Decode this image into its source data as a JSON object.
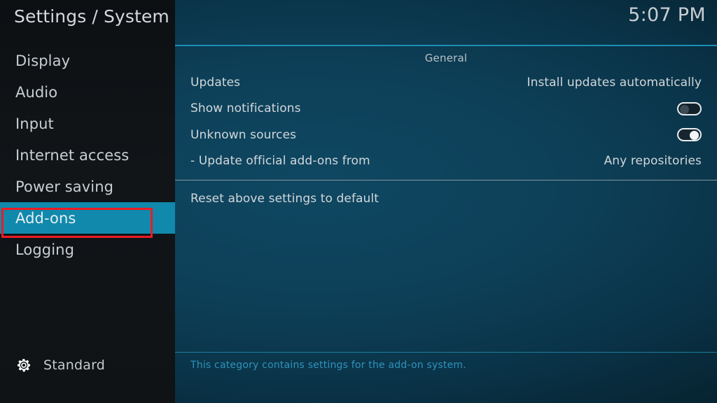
{
  "header": {
    "title": "Settings / System",
    "clock": "5:07 PM"
  },
  "sidebar": {
    "items": [
      {
        "label": "Display",
        "selected": false
      },
      {
        "label": "Audio",
        "selected": false
      },
      {
        "label": "Input",
        "selected": false
      },
      {
        "label": "Internet access",
        "selected": false
      },
      {
        "label": "Power saving",
        "selected": false
      },
      {
        "label": "Add-ons",
        "selected": true
      },
      {
        "label": "Logging",
        "selected": false
      }
    ],
    "level": {
      "icon": "gear-icon",
      "label": "Standard"
    }
  },
  "main": {
    "section_header": "General",
    "rows": [
      {
        "label": "Updates",
        "value": "Install updates automatically",
        "type": "value"
      },
      {
        "label": "Show notifications",
        "value": "off",
        "type": "toggle"
      },
      {
        "label": "Unknown sources",
        "value": "on",
        "type": "toggle"
      },
      {
        "label": "- Update official add-ons from",
        "value": "Any repositories",
        "type": "value"
      },
      {
        "label": "Reset above settings to default",
        "value": "",
        "type": "action"
      }
    ],
    "help_text": "This category contains settings for the add-on system."
  },
  "annotation": {
    "target": "Add-ons",
    "color": "#ec1c24"
  },
  "colors": {
    "accent_teal": "#1089ad",
    "rule_teal": "#1b8fb4",
    "help_teal": "#2e93bb",
    "sidebar_bg": "#101417",
    "content_bg": "#0d4058",
    "annotation_red": "#ec1c24"
  }
}
